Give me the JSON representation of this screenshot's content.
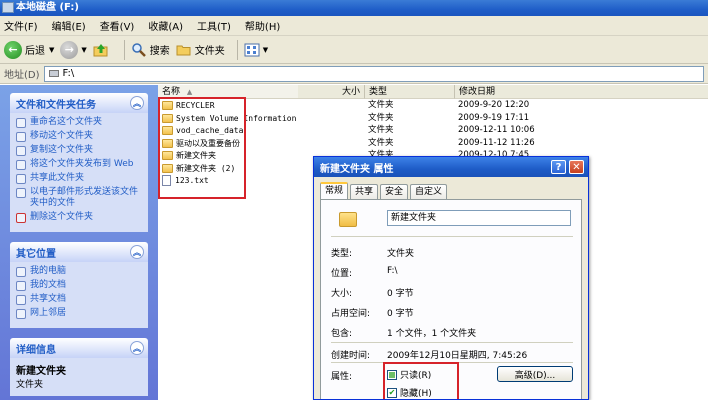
{
  "window": {
    "title": "本地磁盘 (F:)"
  },
  "menu": [
    "文件(F)",
    "编辑(E)",
    "查看(V)",
    "收藏(A)",
    "工具(T)",
    "帮助(H)"
  ],
  "toolbar": {
    "back": "后退",
    "search": "搜索",
    "folders": "文件夹"
  },
  "address": {
    "label": "地址(D)",
    "path": "F:\\"
  },
  "tasks_panel": {
    "title": "文件和文件夹任务",
    "items": [
      "重命名这个文件夹",
      "移动这个文件夹",
      "复制这个文件夹",
      "将这个文件夹发布到 Web",
      "共享此文件夹",
      "以电子邮件形式发送该文件夹中的文件",
      "删除这个文件夹"
    ]
  },
  "places_panel": {
    "title": "其它位置",
    "items": [
      "我的电脑",
      "我的文档",
      "共享文档",
      "网上邻居"
    ]
  },
  "details_panel": {
    "title": "详细信息",
    "name": "新建文件夹",
    "type": "文件夹"
  },
  "columns": {
    "name": "名称",
    "size": "大小",
    "type": "类型",
    "modified": "修改日期"
  },
  "files": [
    {
      "name": "RECYCLER",
      "type": "文件夹",
      "date": "2009-9-20 12:20",
      "kind": "folder"
    },
    {
      "name": "System Volume Information",
      "type": "文件夹",
      "date": "2009-9-19 17:11",
      "kind": "folder"
    },
    {
      "name": "vod_cache_data",
      "type": "文件夹",
      "date": "2009-12-11 10:06",
      "kind": "folder"
    },
    {
      "name": "驱动以及重要备份",
      "type": "文件夹",
      "date": "2009-11-12 11:26",
      "kind": "folder"
    },
    {
      "name": "新建文件夹",
      "type": "文件夹",
      "date": "2009-12-10 7:45",
      "kind": "folder"
    },
    {
      "name": "新建文件夹 (2)",
      "type": "",
      "date": "",
      "kind": "folder"
    },
    {
      "name": "123.txt",
      "type": "",
      "date": "",
      "kind": "text"
    }
  ],
  "dialog": {
    "title": "新建文件夹 属性",
    "tabs": [
      "常规",
      "共享",
      "安全",
      "自定义"
    ],
    "name": "新建文件夹",
    "props": [
      {
        "label": "类型:",
        "value": "文件夹"
      },
      {
        "label": "位置:",
        "value": "F:\\"
      },
      {
        "label": "大小:",
        "value": "0 字节"
      },
      {
        "label": "占用空间:",
        "value": "0 字节"
      },
      {
        "label": "包含:",
        "value": "1 个文件，1 个文件夹"
      },
      {
        "label": "创建时间:",
        "value": "2009年12月10日星期四, 7:45:26"
      }
    ],
    "attributes_label": "属性:",
    "readonly_label": "只读(R)",
    "hidden_label": "隐藏(H)",
    "advanced_label": "高级(D)..."
  }
}
